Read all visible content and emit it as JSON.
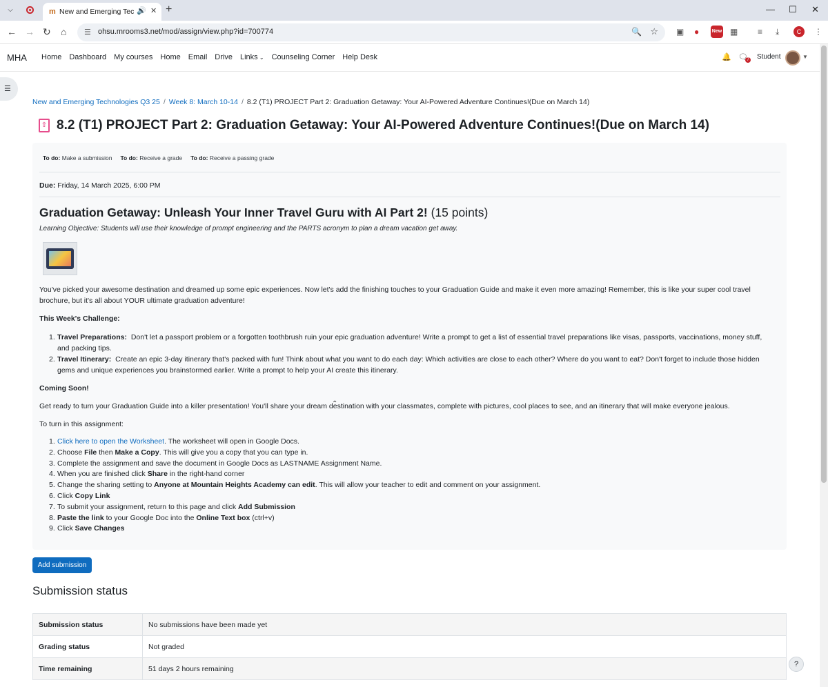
{
  "browser": {
    "tab_title": "New and Emerging Technol",
    "favicon": "m-favicon",
    "url": "ohsu.mrooms3.net/mod/assign/view.php?id=700774",
    "ext_badge": "New",
    "profile_initial": "C"
  },
  "navbar": {
    "brand": "MHA",
    "links": [
      "Home",
      "Dashboard",
      "My courses",
      "Home",
      "Email",
      "Drive",
      "Links",
      "Counseling Corner",
      "Help Desk"
    ],
    "chat_badge": "7",
    "user": "Student"
  },
  "breadcrumb": {
    "course": "New and Emerging Technologies Q3 25",
    "week": "Week 8: March 10-14",
    "current": "8.2 (T1) PROJECT Part 2: Graduation Getaway: Your AI-Powered Adventure Continues!(Due on March 14)"
  },
  "page_title": "8.2 (T1) PROJECT Part 2: Graduation Getaway: Your AI-Powered Adventure Continues!(Due on March 14)",
  "todos": [
    {
      "label": "To do:",
      "text": "Make a submission"
    },
    {
      "label": "To do:",
      "text": "Receive a grade"
    },
    {
      "label": "To do:",
      "text": "Receive a passing grade"
    }
  ],
  "due": {
    "label": "Due:",
    "value": "Friday, 14 March 2025, 6:00 PM"
  },
  "intro": {
    "title": "Graduation Getaway: Unleash Your Inner Travel Guru with AI Part 2!",
    "points": "(15 points)",
    "objective": "Learning Objective: Students will use their knowledge of prompt engineering and the PARTS acronym to plan a dream vacation get away.",
    "para1": "You've picked your awesome destination and dreamed up some epic experiences. Now let's add the finishing touches to your Graduation Guide and make it even more amazing! Remember, this is like your super cool travel brochure, but it's all about YOUR ultimate graduation adventure!",
    "challenge_heading": "This Week's Challenge:",
    "challenges": [
      {
        "bold": "Travel Preparations:",
        "text": "Don't let a passport problem or a forgotten toothbrush ruin your epic graduation adventure! Write a prompt to get a list of essential travel preparations like visas, passports, vaccinations, money stuff, and packing tips."
      },
      {
        "bold": "Travel Itinerary:",
        "text": "Create an epic 3-day itinerary that's packed with fun! Think about what you want to do each day: Which activities are close to each other? Where do you want to eat? Don't forget to include those hidden gems and unique experiences you brainstormed earlier. Write a prompt to help your AI create this itinerary."
      }
    ],
    "coming_heading": "Coming Soon!",
    "coming_text": "Get ready to turn your Graduation Guide into a killer presentation! You'll share your dream destination with your classmates, complete with pictures, cool places to see, and an itinerary that will make everyone jealous.",
    "turn_in": "To turn in this assignment:"
  },
  "steps": {
    "s1_link": "Click here to open the Worksheet",
    "s1_rest": ". The worksheet will open in Google Docs.",
    "s2_a": "Choose ",
    "s2_b": "File",
    "s2_c": " then ",
    "s2_d": "Make a Copy",
    "s2_e": ". This will give you a copy that you can type in.",
    "s3": "Complete the assignment and save the document in Google Docs as LASTNAME Assignment Name.",
    "s4_a": "When you are finished click ",
    "s4_b": "Share",
    "s4_c": " in the right-hand corner",
    "s5_a": "Change the sharing setting to ",
    "s5_b": "Anyone at Mountain Heights Academy can edit",
    "s5_c": ". This will allow your teacher to edit and comment on your assignment.",
    "s6_a": "Click ",
    "s6_b": "Copy Link",
    "s7_a": "To submit your assignment, return to this page and click ",
    "s7_b": "Add Submission",
    "s8_a": "Paste the link",
    "s8_b": " to your Google Doc into the ",
    "s8_c": "Online Text box",
    "s8_d": " (ctrl+v)",
    "s9_a": "Click ",
    "s9_b": "Save Changes"
  },
  "add_submission": "Add submission",
  "submission_heading": "Submission status",
  "status_rows": [
    {
      "label": "Submission status",
      "value": "No submissions have been made yet"
    },
    {
      "label": "Grading status",
      "value": "Not graded"
    },
    {
      "label": "Time remaining",
      "value": "51 days 2 hours remaining"
    }
  ],
  "help": "?"
}
